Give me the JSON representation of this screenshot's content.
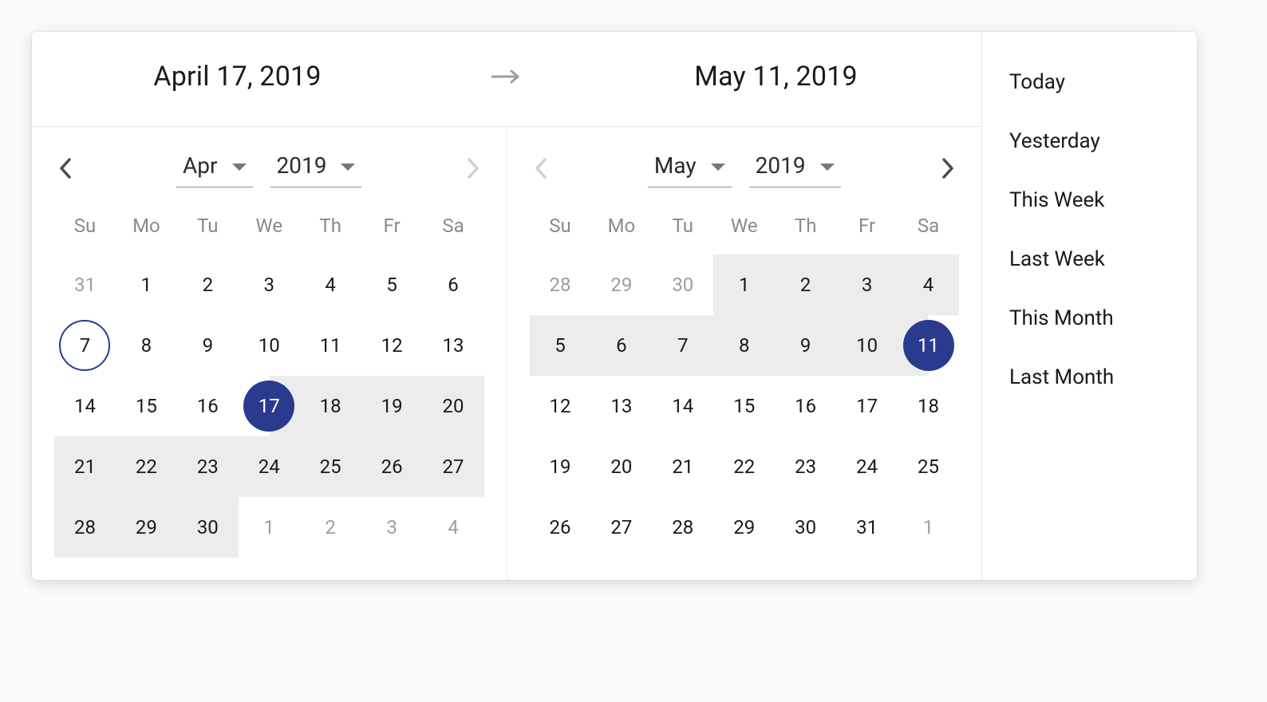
{
  "header": {
    "start_label": "April 17, 2019",
    "end_label": "May 11, 2019",
    "arrow_icon": "arrow-right-icon"
  },
  "weekdays": [
    "Su",
    "Mo",
    "Tu",
    "We",
    "Th",
    "Fr",
    "Sa"
  ],
  "calendars": [
    {
      "id": "start",
      "month_label": "Apr",
      "year_label": "2019",
      "prev_enabled": true,
      "next_enabled": false,
      "days": [
        {
          "n": "31",
          "other": true
        },
        {
          "n": "1"
        },
        {
          "n": "2"
        },
        {
          "n": "3"
        },
        {
          "n": "4"
        },
        {
          "n": "5"
        },
        {
          "n": "6"
        },
        {
          "n": "7",
          "today": true
        },
        {
          "n": "8"
        },
        {
          "n": "9"
        },
        {
          "n": "10"
        },
        {
          "n": "11"
        },
        {
          "n": "12"
        },
        {
          "n": "13"
        },
        {
          "n": "14"
        },
        {
          "n": "15"
        },
        {
          "n": "16"
        },
        {
          "n": "17",
          "selected": true,
          "range_start": true
        },
        {
          "n": "18",
          "in_range": true
        },
        {
          "n": "19",
          "in_range": true
        },
        {
          "n": "20",
          "in_range": true
        },
        {
          "n": "21",
          "in_range": true
        },
        {
          "n": "22",
          "in_range": true
        },
        {
          "n": "23",
          "in_range": true
        },
        {
          "n": "24",
          "in_range": true
        },
        {
          "n": "25",
          "in_range": true
        },
        {
          "n": "26",
          "in_range": true
        },
        {
          "n": "27",
          "in_range": true
        },
        {
          "n": "28",
          "in_range": true
        },
        {
          "n": "29",
          "in_range": true
        },
        {
          "n": "30",
          "in_range": true
        },
        {
          "n": "1",
          "other": true
        },
        {
          "n": "2",
          "other": true
        },
        {
          "n": "3",
          "other": true
        },
        {
          "n": "4",
          "other": true
        }
      ]
    },
    {
      "id": "end",
      "month_label": "May",
      "year_label": "2019",
      "prev_enabled": false,
      "next_enabled": true,
      "days": [
        {
          "n": "28",
          "other": true
        },
        {
          "n": "29",
          "other": true
        },
        {
          "n": "30",
          "other": true
        },
        {
          "n": "1",
          "in_range": true
        },
        {
          "n": "2",
          "in_range": true
        },
        {
          "n": "3",
          "in_range": true
        },
        {
          "n": "4",
          "in_range": true
        },
        {
          "n": "5",
          "in_range": true
        },
        {
          "n": "6",
          "in_range": true
        },
        {
          "n": "7",
          "in_range": true
        },
        {
          "n": "8",
          "in_range": true
        },
        {
          "n": "9",
          "in_range": true
        },
        {
          "n": "10",
          "in_range": true
        },
        {
          "n": "11",
          "selected": true,
          "range_end": true
        },
        {
          "n": "12"
        },
        {
          "n": "13"
        },
        {
          "n": "14"
        },
        {
          "n": "15"
        },
        {
          "n": "16"
        },
        {
          "n": "17"
        },
        {
          "n": "18"
        },
        {
          "n": "19"
        },
        {
          "n": "20"
        },
        {
          "n": "21"
        },
        {
          "n": "22"
        },
        {
          "n": "23"
        },
        {
          "n": "24"
        },
        {
          "n": "25"
        },
        {
          "n": "26"
        },
        {
          "n": "27"
        },
        {
          "n": "28"
        },
        {
          "n": "29"
        },
        {
          "n": "30"
        },
        {
          "n": "31"
        },
        {
          "n": "1",
          "other": true
        }
      ]
    }
  ],
  "presets": [
    {
      "label": "Today"
    },
    {
      "label": "Yesterday"
    },
    {
      "label": "This Week"
    },
    {
      "label": "Last Week"
    },
    {
      "label": "This Month"
    },
    {
      "label": "Last Month"
    }
  ],
  "colors": {
    "accent": "#2a3b8f",
    "range_bg": "#ececec"
  }
}
